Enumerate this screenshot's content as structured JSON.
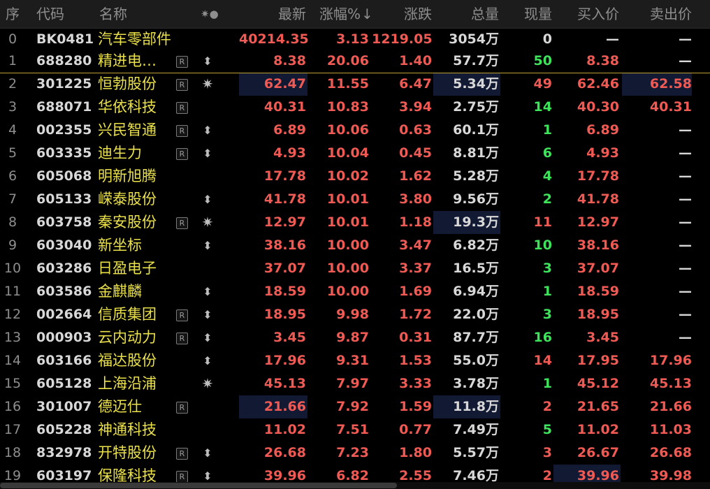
{
  "headers": {
    "seq": "序",
    "code": "代码",
    "name": "名称",
    "flag": "✷●",
    "last": "最新",
    "pct": "涨幅%",
    "pct_sort": "↓",
    "chg": "涨跌",
    "vol": "总量",
    "cur": "现量",
    "bid": "买入价",
    "ask": "卖出价"
  },
  "colors": {
    "up": "#f05a55",
    "down": "#3ee35c",
    "name": "#e9e04a",
    "highlight": "#121a33"
  },
  "rows": [
    {
      "seq": "0",
      "code": "BK0481",
      "name": "汽车零部件",
      "r": "",
      "flag": "",
      "last": "40214.35",
      "pct": "3.13",
      "chg": "1219.05",
      "vol": "3054万",
      "cur": "0",
      "bid": "—",
      "ask": "—"
    },
    {
      "seq": "1",
      "code": "688280",
      "name": "精进电…",
      "r": "R",
      "flag": "⬍",
      "last": "8.38",
      "pct": "20.06",
      "chg": "1.40",
      "vol": "57.7万",
      "cur": "50",
      "bid": "8.38",
      "ask": "—"
    },
    {
      "seq": "2",
      "code": "301225",
      "name": "恒勃股份",
      "r": "R",
      "flag": "✷",
      "last": "62.47",
      "pct": "11.55",
      "chg": "6.47",
      "vol": "5.34万",
      "cur": "49",
      "bid": "62.46",
      "ask": "62.58"
    },
    {
      "seq": "3",
      "code": "688071",
      "name": "华依科技",
      "r": "R",
      "flag": "",
      "last": "40.31",
      "pct": "10.83",
      "chg": "3.94",
      "vol": "2.75万",
      "cur": "14",
      "bid": "40.30",
      "ask": "40.31"
    },
    {
      "seq": "4",
      "code": "002355",
      "name": "兴民智通",
      "r": "R",
      "flag": "⬍",
      "last": "6.89",
      "pct": "10.06",
      "chg": "0.63",
      "vol": "60.1万",
      "cur": "1",
      "bid": "6.89",
      "ask": "—"
    },
    {
      "seq": "5",
      "code": "603335",
      "name": "迪生力",
      "r": "R",
      "flag": "⬍",
      "last": "4.93",
      "pct": "10.04",
      "chg": "0.45",
      "vol": "8.81万",
      "cur": "6",
      "bid": "4.93",
      "ask": "—"
    },
    {
      "seq": "6",
      "code": "605068",
      "name": "明新旭腾",
      "r": "",
      "flag": "",
      "last": "17.78",
      "pct": "10.02",
      "chg": "1.62",
      "vol": "5.28万",
      "cur": "4",
      "bid": "17.78",
      "ask": "—"
    },
    {
      "seq": "7",
      "code": "605133",
      "name": "嵘泰股份",
      "r": "",
      "flag": "⬍",
      "last": "41.78",
      "pct": "10.01",
      "chg": "3.80",
      "vol": "9.56万",
      "cur": "2",
      "bid": "41.78",
      "ask": "—"
    },
    {
      "seq": "8",
      "code": "603758",
      "name": "秦安股份",
      "r": "R",
      "flag": "✷",
      "last": "12.97",
      "pct": "10.01",
      "chg": "1.18",
      "vol": "19.3万",
      "cur": "11",
      "bid": "12.97",
      "ask": "—"
    },
    {
      "seq": "9",
      "code": "603040",
      "name": "新坐标",
      "r": "",
      "flag": "⬍",
      "last": "38.16",
      "pct": "10.00",
      "chg": "3.47",
      "vol": "6.82万",
      "cur": "10",
      "bid": "38.16",
      "ask": "—"
    },
    {
      "seq": "10",
      "code": "603286",
      "name": "日盈电子",
      "r": "",
      "flag": "",
      "last": "37.07",
      "pct": "10.00",
      "chg": "3.37",
      "vol": "16.5万",
      "cur": "3",
      "bid": "37.07",
      "ask": "—"
    },
    {
      "seq": "11",
      "code": "603586",
      "name": "金麒麟",
      "r": "",
      "flag": "⬍",
      "last": "18.59",
      "pct": "10.00",
      "chg": "1.69",
      "vol": "6.94万",
      "cur": "1",
      "bid": "18.59",
      "ask": "—"
    },
    {
      "seq": "12",
      "code": "002664",
      "name": "信质集团",
      "r": "R",
      "flag": "⬍",
      "last": "18.95",
      "pct": "9.98",
      "chg": "1.72",
      "vol": "22.0万",
      "cur": "3",
      "bid": "18.95",
      "ask": "—"
    },
    {
      "seq": "13",
      "code": "000903",
      "name": "云内动力",
      "r": "R",
      "flag": "⬍",
      "last": "3.45",
      "pct": "9.87",
      "chg": "0.31",
      "vol": "87.7万",
      "cur": "16",
      "bid": "3.45",
      "ask": "—"
    },
    {
      "seq": "14",
      "code": "603166",
      "name": "福达股份",
      "r": "",
      "flag": "⬍",
      "last": "17.96",
      "pct": "9.31",
      "chg": "1.53",
      "vol": "55.0万",
      "cur": "14",
      "bid": "17.95",
      "ask": "17.96"
    },
    {
      "seq": "15",
      "code": "605128",
      "name": "上海沿浦",
      "r": "",
      "flag": "✷",
      "last": "45.13",
      "pct": "7.97",
      "chg": "3.33",
      "vol": "3.78万",
      "cur": "1",
      "bid": "45.12",
      "ask": "45.13"
    },
    {
      "seq": "16",
      "code": "301007",
      "name": "德迈仕",
      "r": "R",
      "flag": "",
      "last": "21.66",
      "pct": "7.92",
      "chg": "1.59",
      "vol": "11.8万",
      "cur": "2",
      "bid": "21.65",
      "ask": "21.66"
    },
    {
      "seq": "17",
      "code": "605228",
      "name": "神通科技",
      "r": "",
      "flag": "",
      "last": "11.02",
      "pct": "7.51",
      "chg": "0.77",
      "vol": "7.49万",
      "cur": "5",
      "bid": "11.02",
      "ask": "11.03"
    },
    {
      "seq": "18",
      "code": "832978",
      "name": "开特股份",
      "r": "R",
      "flag": "⬍",
      "last": "26.68",
      "pct": "7.23",
      "chg": "1.80",
      "vol": "5.57万",
      "cur": "3",
      "bid": "26.67",
      "ask": "26.68"
    },
    {
      "seq": "19",
      "code": "603197",
      "name": "保隆科技",
      "r": "R",
      "flag": "⬍",
      "last": "39.96",
      "pct": "6.82",
      "chg": "2.55",
      "vol": "7.46万",
      "cur": "2",
      "bid": "39.96",
      "ask": "39.98"
    }
  ]
}
